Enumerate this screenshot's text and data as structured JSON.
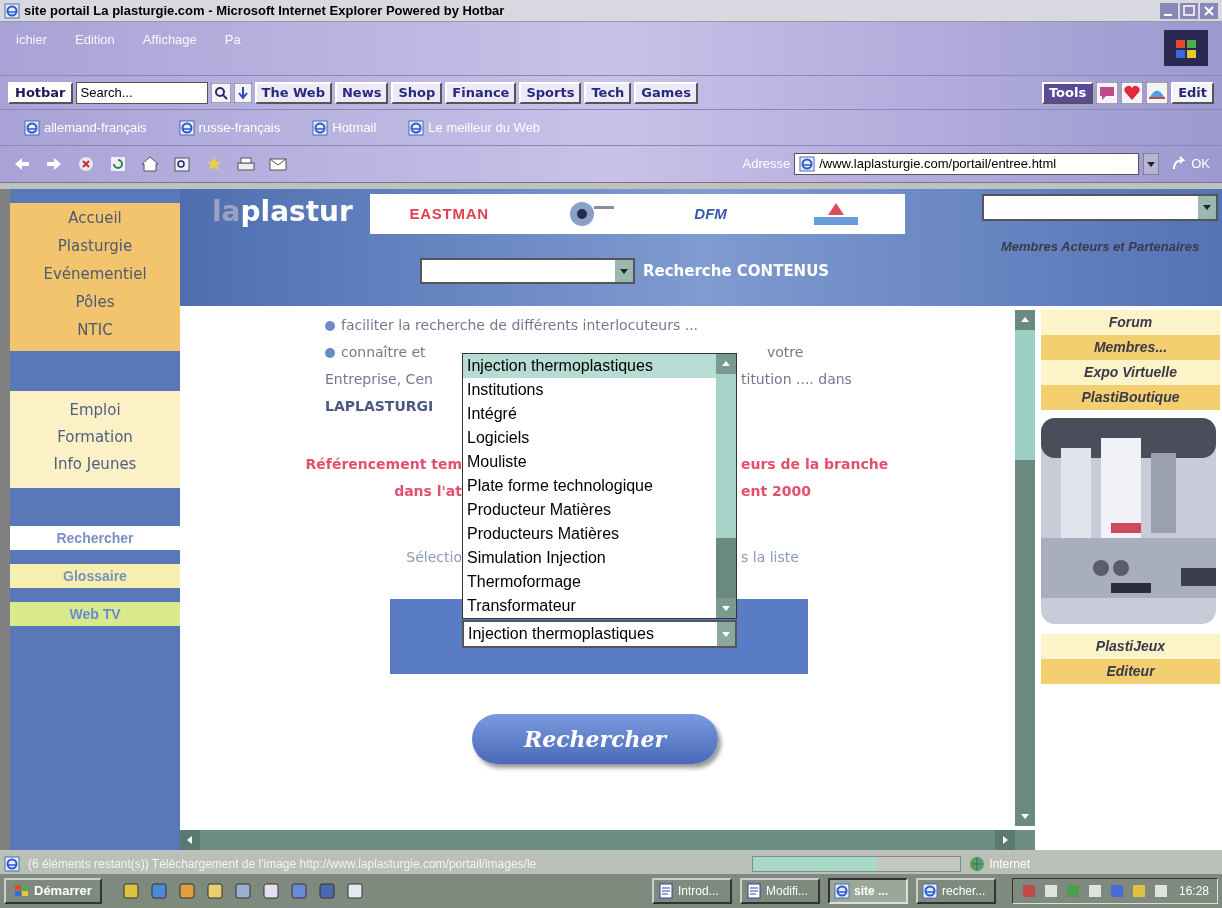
{
  "window": {
    "title": "site portail La plasturgie.com - Microsoft Internet Explorer Powered by Hotbar"
  },
  "menu_bar": [
    "ichier",
    "Edition",
    "Affichage",
    "Pa"
  ],
  "hotbar": {
    "search": {
      "placeholder": "Search..."
    },
    "buttons": [
      {
        "label": "Hotbar",
        "kind": "brand"
      },
      {
        "label": "The Web",
        "kind": "channel"
      },
      {
        "label": "News",
        "kind": "channel"
      },
      {
        "label": "Shop",
        "kind": "channel"
      },
      {
        "label": "Finance",
        "kind": "channel"
      },
      {
        "label": "Sports",
        "kind": "channel"
      },
      {
        "label": "Tech",
        "kind": "channel"
      },
      {
        "label": "Games",
        "kind": "channel"
      }
    ],
    "right_buttons": [
      {
        "label": "Tools",
        "kind": "tools"
      },
      {
        "label": "Edit",
        "kind": "edit"
      }
    ]
  },
  "links": [
    "allemand-français",
    "russe-français",
    "Hotmail",
    "Le meilleur du Web"
  ],
  "address": {
    "label": "Adresse",
    "value": "/www.laplasturgie.com/portail/entree.html",
    "go": "OK"
  },
  "sidebar": {
    "groups": [
      {
        "kind": "orange",
        "items": [
          {
            "label": "Accueil",
            "selected": false
          },
          {
            "label": "Plasturgie",
            "selected": false
          },
          {
            "label": "Evénementiel",
            "selected": false
          },
          {
            "label": "Pôles",
            "selected": false
          },
          {
            "label": "NTIC",
            "selected": false
          }
        ]
      },
      {
        "kind": "cream",
        "items": [
          {
            "label": "Emploi",
            "selected": false
          },
          {
            "label": "Formation",
            "selected": false
          },
          {
            "label": "Info Jeunes",
            "selected": false
          }
        ]
      },
      {
        "kind": "tab",
        "items": [
          {
            "label": "Rechercher",
            "selected": true
          }
        ]
      },
      {
        "kind": "tab",
        "items": [
          {
            "label": "Glossaire",
            "selected": false
          }
        ]
      },
      {
        "kind": "lime",
        "items": [
          {
            "label": "Web TV",
            "selected": false
          }
        ]
      }
    ]
  },
  "header": {
    "logo_light": "la",
    "logo": "plastur",
    "sponsors": [
      {
        "kind": "text",
        "label": "EASTMAN"
      },
      {
        "kind": "emblem"
      },
      {
        "kind": "italic",
        "label": "DFM"
      },
      {
        "kind": "mountain"
      }
    ],
    "search_label": "Recherche CONTENUS",
    "members_label": "Membres Acteurs et Partenaires"
  },
  "content": {
    "lines": [
      {
        "kind": "bullet",
        "left": "faciliter la recherche de différents interlocuteurs ..."
      },
      {
        "kind": "bullet",
        "left": "connaître et",
        "right": "votre"
      },
      {
        "kind": "plain",
        "left": "Entreprise, Cen",
        "right": "titution .... dans"
      },
      {
        "kind": "strong",
        "left": "LAPLASTURGI"
      },
      {
        "kind": "red",
        "left": "Référencement tem",
        "right": "eurs de la branche"
      },
      {
        "kind": "red",
        "left": "dans l'at",
        "right": "ent 2000"
      },
      {
        "kind": "hint",
        "left": "Sélectio",
        "right": "s la liste"
      }
    ],
    "dropdown": [
      {
        "label": "Injection thermoplastiques",
        "selected": true
      },
      {
        "label": "Institutions",
        "selected": false
      },
      {
        "label": "Intégré",
        "selected": false
      },
      {
        "label": "Logiciels",
        "selected": false
      },
      {
        "label": "Mouliste",
        "selected": false
      },
      {
        "label": "Plate forme technologique",
        "selected": false
      },
      {
        "label": "Producteur Matières",
        "selected": false
      },
      {
        "label": "Producteurs Matières",
        "selected": false
      },
      {
        "label": "Simulation Injection",
        "selected": false
      },
      {
        "label": "Thermoformage",
        "selected": false
      },
      {
        "label": "Transformateur",
        "selected": false
      }
    ],
    "select_value": "Injection thermoplastiques",
    "button": "Rechercher"
  },
  "right_column": {
    "top": [
      {
        "label": "Forum",
        "kind": "cream"
      },
      {
        "label": "Membres...",
        "kind": "orange"
      },
      {
        "label": "Expo Virtuelle",
        "kind": "cream"
      },
      {
        "label": "PlastiBoutique",
        "kind": "orange"
      }
    ],
    "bottom": [
      {
        "label": "PlastiJeux",
        "kind": "cream"
      },
      {
        "label": "Editeur",
        "kind": "orange"
      }
    ]
  },
  "status_bar": {
    "text": "(6 éléments restant(s)) Téléchargement de l'image http://www.laplasturgie.com/portail/images/le",
    "level": 0.6,
    "zone": "Internet"
  },
  "taskbar": {
    "start": "Démarrer",
    "tasks": [
      {
        "label": "Introd...",
        "selected": false,
        "kind": "word"
      },
      {
        "label": "Modifi...",
        "selected": false,
        "kind": "word"
      },
      {
        "label": "site ...",
        "selected": true,
        "kind": "ie"
      },
      {
        "label": "recher...",
        "selected": false,
        "kind": "ie"
      }
    ],
    "clock": "16:28"
  }
}
